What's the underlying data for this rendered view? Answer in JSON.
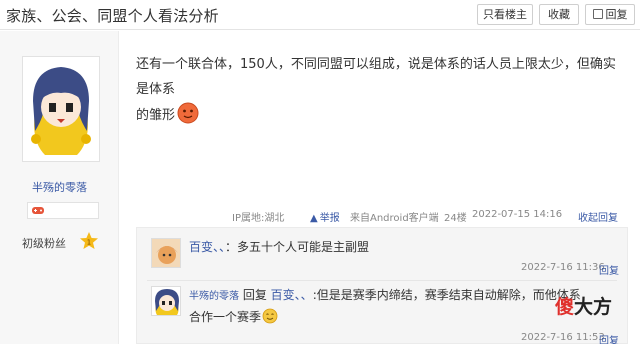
{
  "header": {
    "title": "家族、公会、同盟个人看法分析",
    "btn_only_op": "只看楼主",
    "btn_favorite": "收藏",
    "btn_reply": "回复"
  },
  "author": {
    "username": "半殇的零落",
    "level_name": "初级粉丝",
    "level_number": "1"
  },
  "post": {
    "line1": "还有一个联合体，150人，不同同盟可以组成，说是体系的话人员上限太少，但确实是体系",
    "line2": "的雏形",
    "ip_location": "IP属地:湖北",
    "report": "举报",
    "source": "来自Android客户端",
    "floor": "24楼",
    "time": "2022-07-15 14:16",
    "collapse_reply": "收起回复"
  },
  "replies": [
    {
      "name": "百变、、",
      "text": "多五十个人可能是主副盟",
      "time": "2022-7-16 11:36",
      "reply_link": "回复"
    },
    {
      "name": "半殇的零落",
      "reply_prefix": "回复",
      "reply_to": "百变、、",
      "line1": ":但是是赛季内缔结，赛季结束自动解除，而他体系",
      "line2": "合作一个赛季",
      "time": "2022-7-16 11:53",
      "reply_link": "回复"
    }
  ],
  "watermark": {
    "char1": "傻",
    "rest": "大方"
  }
}
